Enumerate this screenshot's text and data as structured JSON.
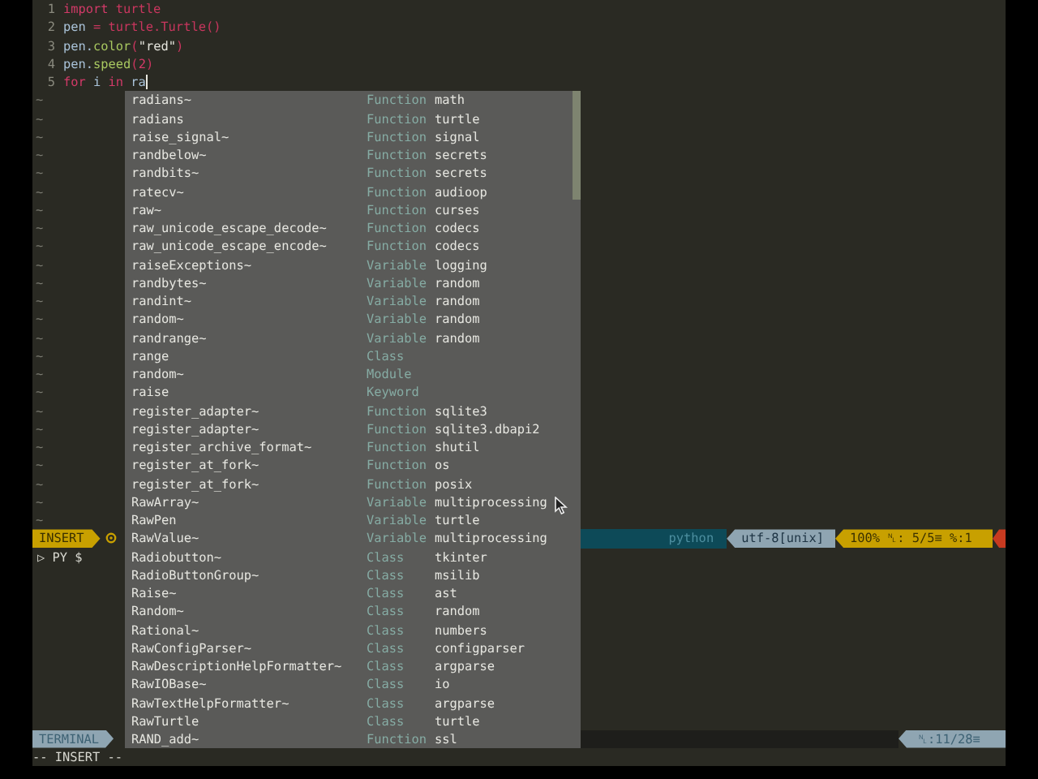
{
  "editor": {
    "lines": [
      {
        "number": "1",
        "tokens": [
          {
            "text": "import",
            "kind": "keyword"
          },
          {
            "text": " turtle",
            "kind": "module"
          }
        ]
      },
      {
        "number": "2",
        "tokens": [
          {
            "text": "pen",
            "kind": "name"
          },
          {
            "text": " = ",
            "kind": "operator"
          },
          {
            "text": "turtle.Turtle()",
            "kind": "module"
          }
        ]
      },
      {
        "number": "3",
        "tokens": [
          {
            "text": "pen.",
            "kind": "name"
          },
          {
            "text": "color",
            "kind": "method"
          },
          {
            "text": "(",
            "kind": "operator"
          },
          {
            "text": "\"red\"",
            "kind": "string"
          },
          {
            "text": ")",
            "kind": "operator"
          }
        ]
      },
      {
        "number": "4",
        "tokens": [
          {
            "text": "pen.",
            "kind": "name"
          },
          {
            "text": "speed",
            "kind": "method"
          },
          {
            "text": "(",
            "kind": "operator"
          },
          {
            "text": "2",
            "kind": "number"
          },
          {
            "text": ")",
            "kind": "operator"
          }
        ]
      },
      {
        "number": "5",
        "tokens": [
          {
            "text": "for",
            "kind": "keyword"
          },
          {
            "text": " i ",
            "kind": "name"
          },
          {
            "text": "in",
            "kind": "keyword"
          },
          {
            "text": " ra",
            "kind": "name"
          }
        ],
        "cursor": true
      }
    ],
    "empty_line_markers": [
      "~",
      "~",
      "~",
      "~",
      "~",
      "~",
      "~",
      "~",
      "~",
      "~",
      "~",
      "~",
      "~",
      "~",
      "~",
      "~",
      "~",
      "~",
      "~",
      "~",
      "~",
      "~",
      "~",
      "~"
    ]
  },
  "status_bar": {
    "mode": "INSERT",
    "filetype": "python",
    "encoding": "utf-8[unix]",
    "position": "100% ␤: 5/5≡ %:1"
  },
  "terminal": {
    "prompt": "▷ PY $"
  },
  "terminal_status": {
    "label": "TERMINAL",
    "position": "␤:11/28≡"
  },
  "command_line": "-- INSERT --",
  "completion_menu": {
    "items": [
      {
        "name": "radians~",
        "type": "Function",
        "module": "math"
      },
      {
        "name": "radians",
        "type": "Function",
        "module": "turtle"
      },
      {
        "name": "raise_signal~",
        "type": "Function",
        "module": "signal"
      },
      {
        "name": "randbelow~",
        "type": "Function",
        "module": "secrets"
      },
      {
        "name": "randbits~",
        "type": "Function",
        "module": "secrets"
      },
      {
        "name": "ratecv~",
        "type": "Function",
        "module": "audioop"
      },
      {
        "name": "raw~",
        "type": "Function",
        "module": "curses"
      },
      {
        "name": "raw_unicode_escape_decode~",
        "type": "Function",
        "module": "codecs"
      },
      {
        "name": "raw_unicode_escape_encode~",
        "type": "Function",
        "module": "codecs"
      },
      {
        "name": "raiseExceptions~",
        "type": "Variable",
        "module": "logging"
      },
      {
        "name": "randbytes~",
        "type": "Variable",
        "module": "random"
      },
      {
        "name": "randint~",
        "type": "Variable",
        "module": "random"
      },
      {
        "name": "random~",
        "type": "Variable",
        "module": "random"
      },
      {
        "name": "randrange~",
        "type": "Variable",
        "module": "random"
      },
      {
        "name": "range",
        "type": "Class"
      },
      {
        "name": "random~",
        "type": "Module"
      },
      {
        "name": "raise",
        "type": "Keyword"
      },
      {
        "name": "register_adapter~",
        "type": "Function",
        "module": "sqlite3"
      },
      {
        "name": "register_adapter~",
        "type": "Function",
        "module": "sqlite3.dbapi2"
      },
      {
        "name": "register_archive_format~",
        "type": "Function",
        "module": "shutil"
      },
      {
        "name": "register_at_fork~",
        "type": "Function",
        "module": "os"
      },
      {
        "name": "register_at_fork~",
        "type": "Function",
        "module": "posix"
      },
      {
        "name": "RawArray~",
        "type": "Variable",
        "module": "multiprocessing"
      },
      {
        "name": "RawPen",
        "type": "Variable",
        "module": "turtle"
      },
      {
        "name": "RawValue~",
        "type": "Variable",
        "module": "multiprocessing"
      },
      {
        "name": "Radiobutton~",
        "type": "Class",
        "module": "tkinter"
      },
      {
        "name": "RadioButtonGroup~",
        "type": "Class",
        "module": "msilib"
      },
      {
        "name": "Raise~",
        "type": "Class",
        "module": "ast"
      },
      {
        "name": "Random~",
        "type": "Class",
        "module": "random"
      },
      {
        "name": "Rational~",
        "type": "Class",
        "module": "numbers"
      },
      {
        "name": "RawConfigParser~",
        "type": "Class",
        "module": "configparser"
      },
      {
        "name": "RawDescriptionHelpFormatter~",
        "type": "Class",
        "module": "argparse"
      },
      {
        "name": "RawIOBase~",
        "type": "Class",
        "module": "io"
      },
      {
        "name": "RawTextHelpFormatter~",
        "type": "Class",
        "module": "argparse"
      },
      {
        "name": "RawTurtle",
        "type": "Class",
        "module": "turtle"
      },
      {
        "name": "RAND_add~",
        "type": "Function",
        "module": "ssl"
      }
    ]
  }
}
